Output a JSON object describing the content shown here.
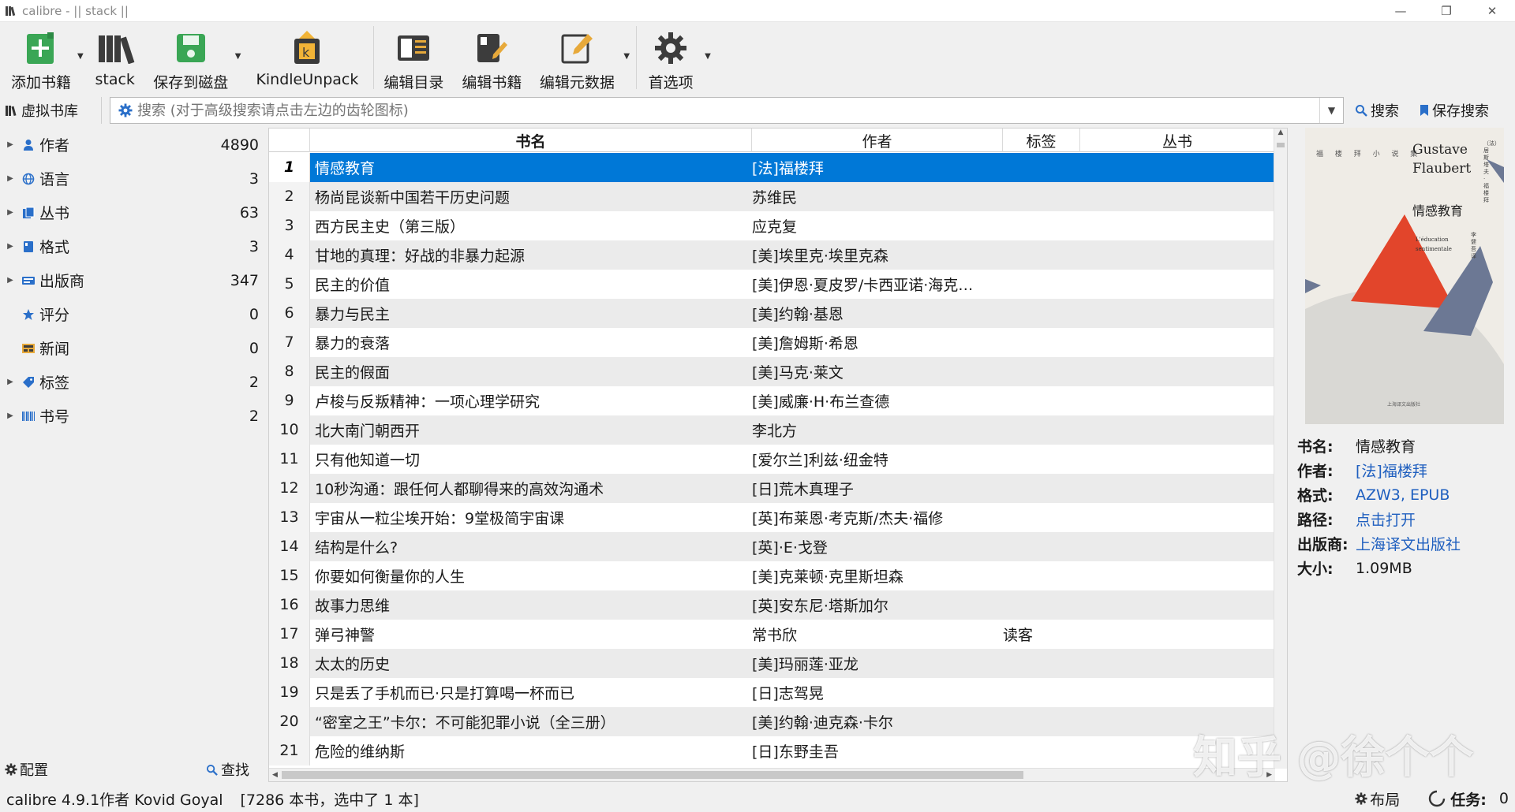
{
  "window": {
    "title": "calibre - || stack ||",
    "minimize": "—",
    "restore": "❐",
    "close": "✕"
  },
  "toolbar": {
    "add_books": "添加书籍",
    "library": "stack",
    "save_to_disk": "保存到磁盘",
    "kindleunpack": "KindleUnpack",
    "edit_toc": "编辑目录",
    "edit_book": "编辑书籍",
    "edit_metadata": "编辑元数据",
    "preferences": "首选项"
  },
  "search": {
    "virtual_library": "虚拟书库",
    "placeholder": "搜索 (对于高级搜索请点击左边的齿轮图标)",
    "search_button": "搜索",
    "save_search_button": "保存搜索"
  },
  "tag_browser": {
    "items": [
      {
        "label": "作者",
        "count": "4890",
        "icon": "person-icon",
        "expandable": true
      },
      {
        "label": "语言",
        "count": "3",
        "icon": "globe-icon",
        "expandable": true
      },
      {
        "label": "丛书",
        "count": "63",
        "icon": "series-icon",
        "expandable": true
      },
      {
        "label": "格式",
        "count": "3",
        "icon": "book-icon",
        "expandable": true
      },
      {
        "label": "出版商",
        "count": "347",
        "icon": "publisher-icon",
        "expandable": true
      },
      {
        "label": "评分",
        "count": "0",
        "icon": "star-icon",
        "expandable": false
      },
      {
        "label": "新闻",
        "count": "0",
        "icon": "news-icon",
        "expandable": false
      },
      {
        "label": "标签",
        "count": "2",
        "icon": "tag-icon",
        "expandable": true
      },
      {
        "label": "书号",
        "count": "2",
        "icon": "barcode-icon",
        "expandable": true
      }
    ],
    "configure": "配置",
    "find": "查找"
  },
  "book_list": {
    "columns": {
      "title": "书名",
      "author": "作者",
      "tags": "标签",
      "series": "丛书"
    },
    "rows": [
      {
        "num": "1",
        "title": "情感教育",
        "author": "[法]福楼拜",
        "tags": ""
      },
      {
        "num": "2",
        "title": "杨尚昆谈新中国若干历史问题",
        "author": "苏维民",
        "tags": ""
      },
      {
        "num": "3",
        "title": "西方民主史（第三版）",
        "author": "应克复",
        "tags": ""
      },
      {
        "num": "4",
        "title": "甘地的真理：好战的非暴力起源",
        "author": "[美]埃里克·埃里克森",
        "tags": ""
      },
      {
        "num": "5",
        "title": "民主的价值",
        "author": "[美]伊恩·夏皮罗/卡西亚诺·海克…",
        "tags": ""
      },
      {
        "num": "6",
        "title": "暴力与民主",
        "author": "[美]约翰·基恩",
        "tags": ""
      },
      {
        "num": "7",
        "title": "暴力的衰落",
        "author": "[美]詹姆斯·希恩",
        "tags": ""
      },
      {
        "num": "8",
        "title": "民主的假面",
        "author": "[美]马克·莱文",
        "tags": ""
      },
      {
        "num": "9",
        "title": "卢梭与反叛精神：一项心理学研究",
        "author": "[美]威廉·H·布兰查德",
        "tags": ""
      },
      {
        "num": "10",
        "title": "北大南门朝西开",
        "author": "李北方",
        "tags": ""
      },
      {
        "num": "11",
        "title": "只有他知道一切",
        "author": "[爱尔兰]利兹·纽金特",
        "tags": ""
      },
      {
        "num": "12",
        "title": "10秒沟通：跟任何人都聊得来的高效沟通术",
        "author": "[日]荒木真理子",
        "tags": ""
      },
      {
        "num": "13",
        "title": "宇宙从一粒尘埃开始：9堂极简宇宙课",
        "author": "[英]布莱恩·考克斯/杰夫·福修",
        "tags": ""
      },
      {
        "num": "14",
        "title": "结构是什么?",
        "author": "[英]·E·戈登",
        "tags": ""
      },
      {
        "num": "15",
        "title": "你要如何衡量你的人生",
        "author": "[美]克莱顿·克里斯坦森",
        "tags": ""
      },
      {
        "num": "16",
        "title": "故事力思维",
        "author": "[英]安东尼·塔斯加尔",
        "tags": ""
      },
      {
        "num": "17",
        "title": "弹弓神警",
        "author": "常书欣",
        "tags": "读客"
      },
      {
        "num": "18",
        "title": "太太的历史",
        "author": "[美]玛丽莲·亚龙",
        "tags": ""
      },
      {
        "num": "19",
        "title": "只是丢了手机而已·只是打算喝一杯而已",
        "author": "[日]志驾晃",
        "tags": ""
      },
      {
        "num": "20",
        "title": "“密室之王”卡尔：不可能犯罪小说（全三册）",
        "author": "[美]约翰·迪克森·卡尔",
        "tags": ""
      },
      {
        "num": "21",
        "title": "危险的维纳斯",
        "author": "[日]东野圭吾",
        "tags": ""
      }
    ]
  },
  "details": {
    "cover": {
      "top_left": "福 楼 拜 小 说 集",
      "author_en_1": "Gustave",
      "author_en_2": "Flaubert",
      "title_cn": "情感教育",
      "subtitle_fr_1": "L'éducation",
      "subtitle_fr_2": "sentimentale",
      "side_vertical": "（法）居斯塔夫·福楼拜",
      "translator": "李健吾 译",
      "publisher_small": "上海译文出版社"
    },
    "title_key": "书名:",
    "title_val": "情感教育",
    "author_key": "作者:",
    "author_val": "[法]福楼拜",
    "format_key": "格式:",
    "format_val": "AZW3, EPUB",
    "path_key": "路径:",
    "path_val": "点击打开",
    "publisher_key": "出版商:",
    "publisher_val": "上海译文出版社",
    "size_key": "大小:",
    "size_val": "1.09MB"
  },
  "watermark": "知乎 @徐个个",
  "status": {
    "version": "calibre 4.9.1作者 Kovid Goyal",
    "count": "[7286 本书，选中了 1 本]",
    "layout": "布局",
    "jobs": "任务:",
    "jobs_count": "0"
  },
  "colors": {
    "selection": "#0078d7",
    "link": "#1f5fbf",
    "add_green": "#3aa655"
  }
}
